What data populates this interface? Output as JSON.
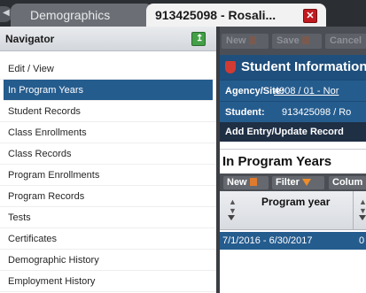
{
  "tabs": [
    {
      "label": "Demographics"
    },
    {
      "label": "913425098 - Rosali..."
    }
  ],
  "navigator": {
    "title": "Navigator",
    "items": [
      {
        "label": "Edit / View"
      },
      {
        "label": "In Program Years"
      },
      {
        "label": "Student Records"
      },
      {
        "label": "Class Enrollments"
      },
      {
        "label": "Class Records"
      },
      {
        "label": "Program Enrollments"
      },
      {
        "label": "Program Records"
      },
      {
        "label": "Tests"
      },
      {
        "label": "Certificates"
      },
      {
        "label": "Demographic History"
      },
      {
        "label": "Employment History"
      }
    ],
    "selected_index": 1
  },
  "toolbar": {
    "new_label": "New",
    "save_label": "Save",
    "cancel_label": "Cancel"
  },
  "student_info": {
    "title": "Student Information",
    "agency_label": "Agency/Site:",
    "agency_value": "4908 / 01 - Nor",
    "student_label": "Student:",
    "student_value": "913425098 / Ro",
    "add_entry_label": "Add Entry/Update Record"
  },
  "section": {
    "title": "In Program Years",
    "new_label": "New",
    "filter_label": "Filter",
    "columns_label": "Colum",
    "column_header": "Program year",
    "rows": [
      {
        "program_year": "7/1/2016 - 6/30/2017",
        "col2": "0"
      }
    ]
  },
  "colors": {
    "selected_blue": "#255c8e",
    "header_blue": "#1f4f7c",
    "close_red": "#c0191f",
    "pin_green": "#43a047"
  }
}
